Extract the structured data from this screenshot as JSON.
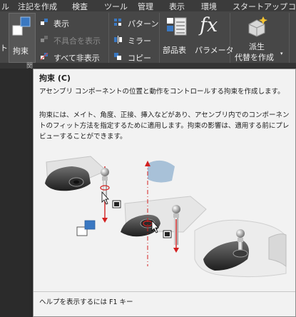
{
  "ribbon": {
    "tabs": [
      {
        "label": "ル"
      },
      {
        "label": "注記を作成"
      },
      {
        "label": "検査"
      },
      {
        "label": "ツール"
      },
      {
        "label": "管理"
      },
      {
        "label": "表示"
      },
      {
        "label": "環境"
      },
      {
        "label": "スタートアップ"
      },
      {
        "label": "コ"
      }
    ],
    "left_cut_label": "ト",
    "constraint_label": "拘束",
    "show_label": "表示",
    "show_errors_label": "不具合を表示",
    "hide_all_label": "すべて非表示",
    "pattern_label": "パターン",
    "mirror_label": "ミラー",
    "copy_label": "コピー",
    "bom_label": "部品表",
    "parameters_label": "パラメータ",
    "derive_label_line1": "派生",
    "derive_label_line2": "代替を作成",
    "panel_label_cut": "関",
    "fx_glyph": "fx",
    "accent_color": "#3a78c2"
  },
  "tooltip": {
    "title": "拘束 (C)",
    "subtitle": "アセンブリ コンポーネントの位置と動作をコントロールする拘束を作成します。",
    "body": "拘束には、メイト、角度、正接、挿入などがあり、アセンブリ内でのコンポーネントのフィット方法を指定するために適用します。拘束の影響は、適用する前にプレビューすることができます。",
    "help": "ヘルプを表示するには F1 キー"
  }
}
